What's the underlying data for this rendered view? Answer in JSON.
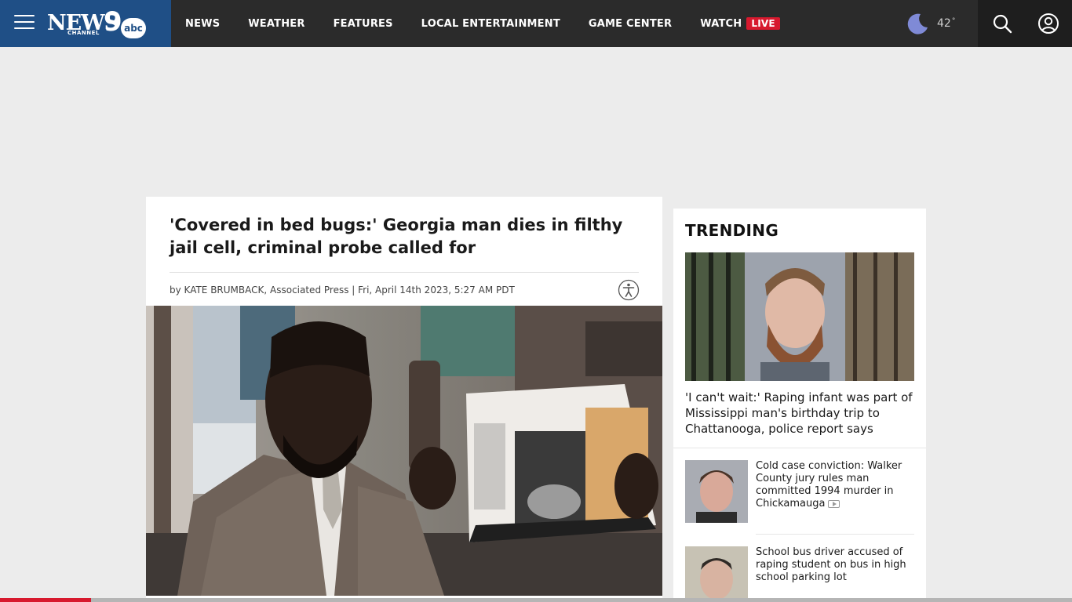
{
  "header": {
    "logo": {
      "news": "NEWS",
      "channel": "CHANNEL",
      "number": "9",
      "network": "abc"
    },
    "nav": [
      {
        "label": "NEWS"
      },
      {
        "label": "WEATHER"
      },
      {
        "label": "FEATURES"
      },
      {
        "label": "LOCAL ENTERTAINMENT"
      },
      {
        "label": "GAME CENTER"
      },
      {
        "label": "WATCH",
        "badge": "LIVE"
      }
    ],
    "weather": {
      "temperature": "42",
      "degree": "°",
      "icon": "moon-icon"
    },
    "icons": {
      "menu": "hamburger-icon",
      "search": "search-icon",
      "account": "user-icon"
    }
  },
  "article": {
    "headline": "'Covered in bed bugs:' Georgia man dies in filthy jail cell, criminal probe called for",
    "byline": "by KATE BRUMBACK, Associated Press | Fri, April 14th 2023, 5:27 AM PDT",
    "accessibility_icon": "accessibility-icon"
  },
  "trending": {
    "title": "TRENDING",
    "items": [
      {
        "title": "'I can't wait:' Raping infant was part of Mississippi man's birthday trip to Chattanooga, police report says"
      },
      {
        "title": "Cold case conviction: Walker County jury rules man committed 1994 murder in Chickamauga",
        "video": true
      },
      {
        "title": "School bus driver accused of raping student on bus in high school parking lot"
      }
    ]
  },
  "reading_progress": 0.085,
  "colors": {
    "nav_bg": "#2b2b2b",
    "logo_bg": "#1f4f86",
    "live_red": "#d7192e",
    "page_bg": "#ececec"
  }
}
